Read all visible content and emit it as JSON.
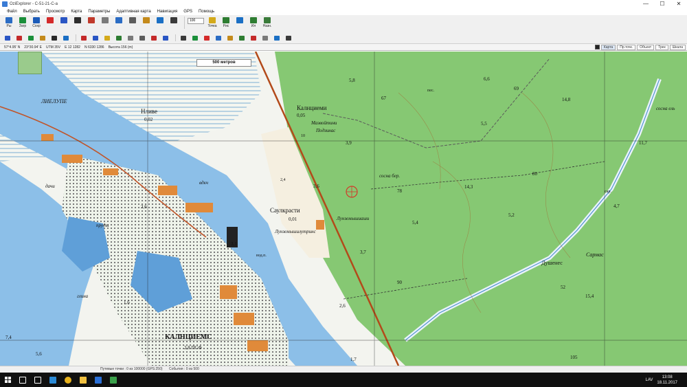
{
  "window": {
    "title": "OziExplorer - C-51-21-C-a",
    "minimize": "—",
    "maximize": "☐",
    "close": "✕"
  },
  "menu": [
    "Файл",
    "Выбрать",
    "Просмотр",
    "Карта",
    "Параметры",
    "Адаптивная карта",
    "Навигация",
    "GPS",
    "Помощь"
  ],
  "toolbar": {
    "row1": [
      {
        "label": "Ры",
        "color": "#2b6cc4"
      },
      {
        "label": "Загр",
        "color": "#1b8f3a"
      },
      {
        "label": "Сохр",
        "color": "#1c5bb8"
      },
      {
        "label": "",
        "color": "#d42a2a"
      },
      {
        "label": "",
        "color": "#2a56c4"
      },
      {
        "label": "",
        "color": "#2d2d2d"
      },
      {
        "label": "",
        "color": "#c0392b"
      },
      {
        "label": "",
        "color": "#7a7a7a"
      },
      {
        "label": "",
        "color": "#2b6cc4"
      },
      {
        "label": "",
        "color": "#5c5c5c"
      },
      {
        "label": "",
        "color": "#c48a1b"
      },
      {
        "label": "",
        "color": "#1b6fc4"
      },
      {
        "label": "",
        "color": "#3a3a3a"
      }
    ],
    "zoom_value": "100",
    "row1b": [
      {
        "label": "Точка",
        "color": "#d4aa1b"
      },
      {
        "label": "Рис",
        "color": "#2e7d32"
      },
      {
        "label": "",
        "color": "#1b6fc4"
      },
      {
        "label": "Ил",
        "color": "#2e7d32"
      },
      {
        "label": "Назн.",
        "color": "#3a7b3a"
      }
    ],
    "row2": [
      "#2a56c4",
      "#c42a2a",
      "#1b8f3a",
      "#c48a1b",
      "#2a2a2a",
      "#1b6fc4",
      "#c42a2a",
      "#2a56c4",
      "#d4aa1b",
      "#2e7d32",
      "#7a7a7a",
      "#5c5c5c",
      "#c42a2a",
      "#2a56c4",
      "#3a3a3a",
      "#1b8f3a",
      "#d42a2a",
      "#2b6cc4",
      "#c48a1b",
      "#2e7d32",
      "#c42a2a",
      "#7a7a7a",
      "#1b6fc4",
      "#3a3a3a"
    ]
  },
  "coords": {
    "lat": "57°4.95' N",
    "lon": "23°30.94' E",
    "zone": "UTM 35V",
    "e": "E 12 1282",
    "n": "N 6330 1286",
    "elev": "Высота 156 (m)"
  },
  "coord_tabs": [
    "Карта",
    "Пр.точк.",
    "Объект",
    "Трек",
    "Шкала"
  ],
  "map": {
    "scale_label": "500 метров",
    "labels": [
      {
        "text": "Калнциеми",
        "size": 9,
        "bold": false,
        "italic": false
      },
      {
        "text": "0,05",
        "size": 7,
        "bold": false,
        "italic": false
      },
      {
        "text": "Мазвойтини",
        "size": 7,
        "bold": false,
        "italic": true
      },
      {
        "text": "Подзинас",
        "size": 7,
        "bold": false,
        "italic": true
      },
      {
        "text": "Нливе",
        "size": 9,
        "bold": false,
        "italic": false
      },
      {
        "text": "0,02",
        "size": 7,
        "bold": false,
        "italic": false
      },
      {
        "text": "Саулкрасти",
        "size": 9,
        "bold": false,
        "italic": false
      },
      {
        "text": "0,01",
        "size": 7,
        "bold": false,
        "italic": false
      },
      {
        "text": "Лунземышиаши",
        "size": 7,
        "bold": false,
        "italic": true
      },
      {
        "text": "Лунземышилутринс",
        "size": 7,
        "bold": false,
        "italic": true
      },
      {
        "text": "КАЛНЦИЕМС",
        "size": 10,
        "bold": true,
        "italic": false
      },
      {
        "text": "2,8 ПСФ",
        "size": 7,
        "bold": false,
        "italic": false
      },
      {
        "text": "Душенес",
        "size": 8,
        "bold": false,
        "italic": false
      },
      {
        "text": "Сармас",
        "size": 8,
        "bold": false,
        "italic": true
      },
      {
        "text": "ЛИЕЛУПЕ",
        "size": 8,
        "bold": false,
        "italic": true
      },
      {
        "text": "вдкч",
        "size": 7,
        "bold": false,
        "italic": true
      },
      {
        "text": "дачи",
        "size": 7,
        "bold": false,
        "italic": true
      },
      {
        "text": "глина",
        "size": 7,
        "bold": false,
        "italic": true
      },
      {
        "text": "пруды",
        "size": 7,
        "bold": false,
        "italic": true
      },
      {
        "text": "сосна бер.",
        "size": 7,
        "bold": false,
        "italic": true
      },
      {
        "text": "сосна ель",
        "size": 7,
        "bold": false,
        "italic": true
      },
      {
        "text": "пес.",
        "size": 6,
        "bold": false,
        "italic": false
      },
      {
        "text": "вод.п.",
        "size": 6,
        "bold": false,
        "italic": false
      },
      {
        "text": "сар.",
        "size": 6,
        "bold": false,
        "italic": false
      },
      {
        "text": "5,8",
        "size": 7,
        "bold": false,
        "italic": false
      },
      {
        "text": "5,5",
        "size": 7,
        "bold": false,
        "italic": false
      },
      {
        "text": "6,6",
        "size": 7,
        "bold": false,
        "italic": false
      },
      {
        "text": "69",
        "size": 7,
        "bold": false,
        "italic": false
      },
      {
        "text": "67",
        "size": 7,
        "bold": false,
        "italic": false
      },
      {
        "text": "14,8",
        "size": 7,
        "bold": false,
        "italic": false
      },
      {
        "text": "11,7",
        "size": 7,
        "bold": false,
        "italic": false
      },
      {
        "text": "3,9",
        "size": 7,
        "bold": false,
        "italic": false
      },
      {
        "text": "3,6",
        "size": 7,
        "bold": false,
        "italic": false
      },
      {
        "text": "78",
        "size": 7,
        "bold": false,
        "italic": false
      },
      {
        "text": "14,3",
        "size": 7,
        "bold": false,
        "italic": false
      },
      {
        "text": "80",
        "size": 7,
        "bold": false,
        "italic": false
      },
      {
        "text": "4,7",
        "size": 7,
        "bold": false,
        "italic": false
      },
      {
        "text": "5,4",
        "size": 7,
        "bold": false,
        "italic": false
      },
      {
        "text": "5,2",
        "size": 7,
        "bold": false,
        "italic": false
      },
      {
        "text": "3,7",
        "size": 7,
        "bold": false,
        "italic": false
      },
      {
        "text": "2,6",
        "size": 7,
        "bold": false,
        "italic": false
      },
      {
        "text": "90",
        "size": 7,
        "bold": false,
        "italic": false
      },
      {
        "text": "52",
        "size": 7,
        "bold": false,
        "italic": false
      },
      {
        "text": "15,4",
        "size": 7,
        "bold": false,
        "italic": false
      },
      {
        "text": "105",
        "size": 7,
        "bold": false,
        "italic": false
      },
      {
        "text": "1,7",
        "size": 7,
        "bold": false,
        "italic": false
      },
      {
        "text": "7,4",
        "size": 7,
        "bold": false,
        "italic": false
      },
      {
        "text": "5,6",
        "size": 7,
        "bold": false,
        "italic": false
      },
      {
        "text": "2,6",
        "size": 7,
        "bold": false,
        "italic": false
      },
      {
        "text": "3,1",
        "size": 7,
        "bold": false,
        "italic": false
      },
      {
        "text": "1,6",
        "size": 7,
        "bold": false,
        "italic": false
      },
      {
        "text": "10",
        "size": 6,
        "bold": false,
        "italic": false
      },
      {
        "text": "2,4",
        "size": 6,
        "bold": false,
        "italic": false
      }
    ]
  },
  "status": {
    "points": "Путевые точки : 0 из 100000 (GPS:250)",
    "events": "События : 0 из 500"
  },
  "taskbar": {
    "apps": [
      {
        "name": "search",
        "color": "#ffffff"
      },
      {
        "name": "task-view",
        "color": "#ffffff"
      },
      {
        "name": "app-blue",
        "color": "#2b8ad6"
      },
      {
        "name": "chrome",
        "color": "#e8b21c"
      },
      {
        "name": "explorer",
        "color": "#f0c040"
      },
      {
        "name": "photoshop",
        "color": "#2a6fd6"
      },
      {
        "name": "oziexplorer",
        "color": "#3aa04a"
      }
    ],
    "lang": "LAV",
    "time": "13:08",
    "date": "18.11.2017"
  }
}
